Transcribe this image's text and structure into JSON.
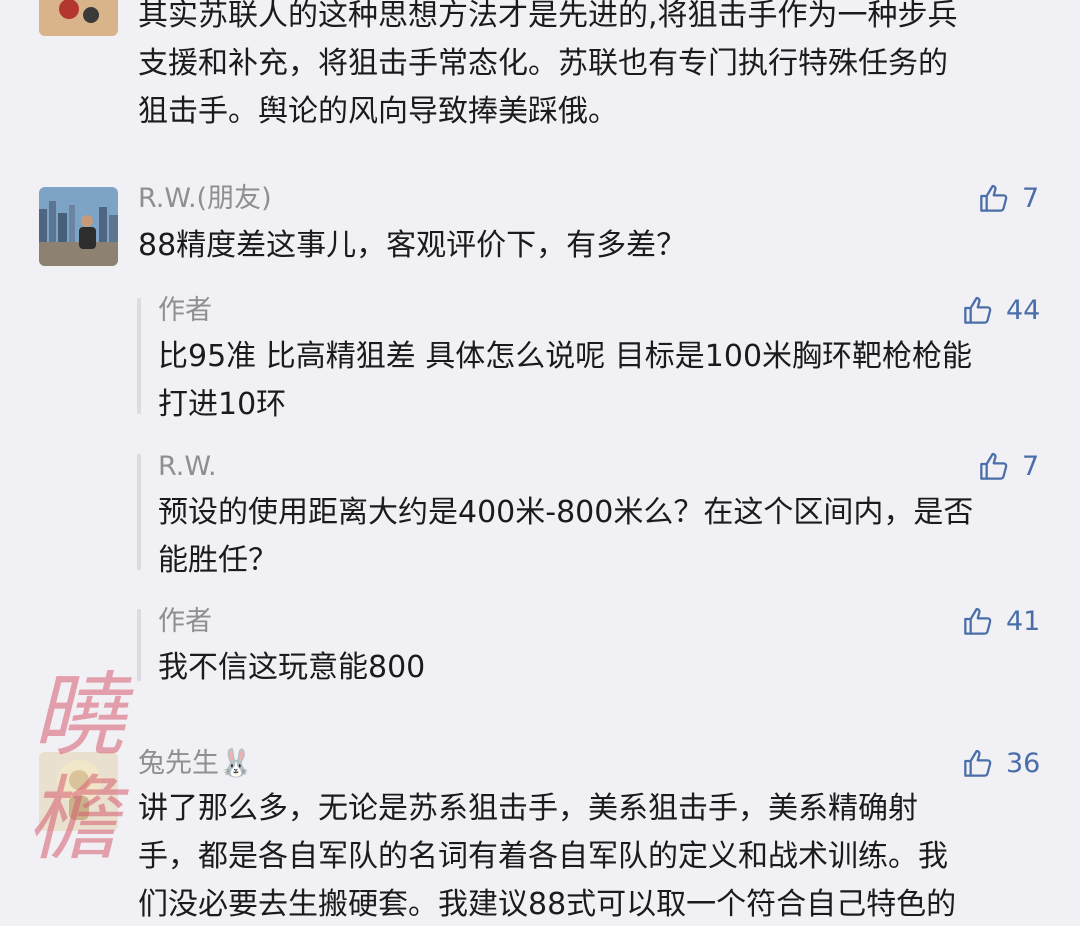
{
  "comment_top": {
    "lines": [
      "其实苏联人的这种思想方法才是先进的,将狙击手作为一种步兵",
      "支援和补充，将狙击手常态化。苏联也有专门执行特殊任务的",
      "狙击手。舆论的风向导致捧美踩俄。"
    ]
  },
  "comment_rw": {
    "username": "R.W.(朋友)",
    "likes": "7",
    "lines": [
      "88精度差这事儿，客观评价下，有多差？"
    ],
    "replies": [
      {
        "username": "作者",
        "likes": "44",
        "lines": [
          "比95准 比高精狙差 具体怎么说呢 目标是100米胸环靶枪枪能",
          "打进10环"
        ]
      },
      {
        "username": "R.W.",
        "likes": "7",
        "lines": [
          "预设的使用距离大约是400米-800米么？在这个区间内，是否",
          "能胜任？"
        ]
      },
      {
        "username": "作者",
        "likes": "41",
        "lines": [
          "我不信这玩意能800"
        ]
      }
    ]
  },
  "comment_rabbit": {
    "username": "兔先生🐰",
    "likes": "36",
    "lines": [
      "讲了那么多，无论是苏系狙击手，美系狙击手，美系精确射",
      "手，都是各自军队的名词有着各自军队的定义和战术训练。我",
      "们没必要去生搬硬套。我建议88式可以取一个符合自己特色的"
    ]
  },
  "watermark": {
    "chars": [
      "曉",
      "檐"
    ]
  },
  "icons": {
    "thumb": "thumbs-up-icon"
  },
  "colors": {
    "background": "#f1f0f4",
    "username": "#8e8e93",
    "like": "#4a6ea9",
    "text": "#1b1b1b"
  }
}
